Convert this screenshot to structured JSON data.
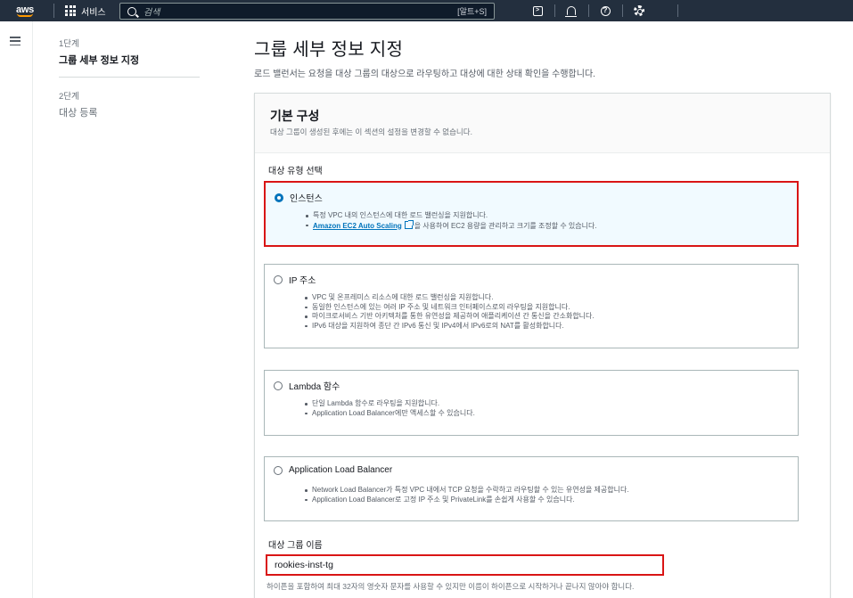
{
  "topnav": {
    "logo": "aws",
    "services_label": "서비스",
    "search_placeholder": "검색",
    "search_shortcut": "[알트+S]",
    "icons": [
      "cloudshell-icon",
      "notifications-icon",
      "help-icon",
      "settings-icon"
    ]
  },
  "sidebar": {
    "steps": [
      {
        "num": "1단계",
        "name": "그룹 세부 정보 지정"
      },
      {
        "num": "2단계",
        "name": "대상 등록"
      }
    ]
  },
  "page": {
    "title": "그룹 세부 정보 지정",
    "description": "로드 밸런서는 요청을 대상 그룹의 대상으로 라우팅하고 대상에 대한 상태 확인을 수행합니다."
  },
  "panel": {
    "title": "기본 구성",
    "subtitle": "대상 그룹이 생성된 후에는 이 섹션의 설정을 변경할 수 없습니다.",
    "target_type_label": "대상 유형 선택",
    "options": [
      {
        "label": "인스턴스",
        "selected": true,
        "bullets": [
          "특정 VPC 내의 인스턴스에 대한 로드 밸런싱을 지원합니다."
        ],
        "link_text": "Amazon EC2 Auto Scaling",
        "link_suffix": "을 사용하여 EC2 용량을 관리하고 크기를 조정할 수 있습니다."
      },
      {
        "label": "IP 주소",
        "selected": false,
        "bullets": [
          "VPC 및 온프레미스 리소스에 대한 로드 밸런싱을 지원합니다.",
          "동일한 인스턴스에 있는 여러 IP 주소 및 네트워크 인터페이스로의 라우팅을 지원합니다.",
          "마이크로서비스 기반 아키텍처를 통한 유연성을 제공하여 애플리케이션 간 통신을 간소화합니다.",
          "IPv6 대상을 지원하여 종단 간 IPv6 통신 및 IPv4에서 IPv6로의 NAT를 활성화합니다."
        ]
      },
      {
        "label": "Lambda 함수",
        "selected": false,
        "bullets": [
          "단일 Lambda 함수로 라우팅을 지원합니다.",
          "Application Load Balancer에만 액세스할 수 있습니다."
        ]
      },
      {
        "label": "Application Load Balancer",
        "selected": false,
        "bullets": [
          "Network Load Balancer가 특정 VPC 내에서 TCP 요청을 수락하고 라우팅할 수 있는 유연성을 제공합니다.",
          "Application Load Balancer로 고정 IP 주소 및 PrivateLink를 손쉽게 사용할 수 있습니다."
        ]
      }
    ],
    "name_label": "대상 그룹 이름",
    "name_value": "rookies-inst-tg",
    "name_hint": "하이픈을 포함하여 최대 32자의 영숫자 문자를 사용할 수 있지만 이름이 하이픈으로 시작하거나 끝나지 않아야 합니다."
  },
  "colors": {
    "nav_bg": "#232f3e",
    "accent": "#0073bb",
    "highlight": "#d91515",
    "selected_bg": "#f1faff"
  }
}
